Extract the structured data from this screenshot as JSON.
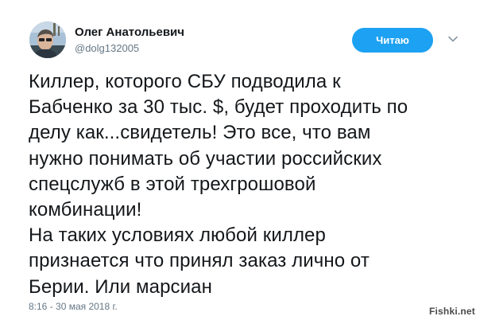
{
  "author": {
    "display_name": "Олег Анатольевич",
    "handle": "@dolg132005"
  },
  "follow_button": {
    "label": "Читаю"
  },
  "tweet": {
    "lines": [
      "Киллер, которого СБУ подводила к",
      "Бабченко за 30 тыс. $, будет проходить по",
      "делу как...свидетель! Это все, что вам",
      "нужно понимать об участии российских",
      "спецслужб в этой трехгрошовой",
      "комбинации!",
      "На таких условиях любой киллер",
      "признается что принял заказ лично от",
      "Берии. Или марсиан"
    ],
    "timestamp": "8:16 - 30 мая 2018 г."
  },
  "watermark": {
    "text": "Fishki.net"
  },
  "icons": {
    "avatar": "user-photo",
    "caret": "chevron-down-icon"
  },
  "colors": {
    "accent": "#1da1f2",
    "text": "#14171a",
    "muted": "#657786"
  }
}
